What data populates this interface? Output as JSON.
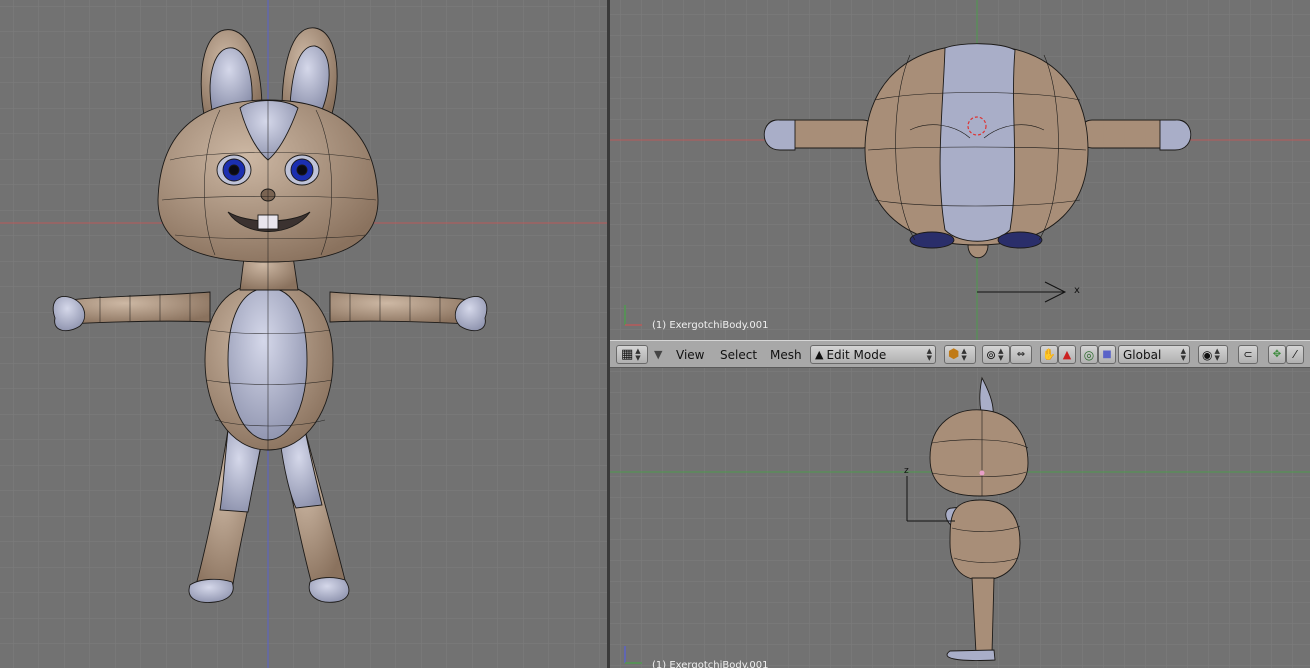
{
  "viewports": {
    "front": {
      "object_label": ""
    },
    "top": {
      "object_label": "(1) ExergotchiBody.001",
      "axis_x_label": "x"
    },
    "side": {
      "object_label": "(1) ExergotchiBody.001",
      "axis_z_label": "z"
    }
  },
  "header": {
    "menus": [
      "View",
      "Select",
      "Mesh"
    ],
    "mode": "Edit Mode",
    "transform_orientation": "Global",
    "icons": {
      "editor_type": "grid-icon",
      "shading": "solid-shading-icon",
      "pivot": "pivot-icon",
      "layers": "layers-icon",
      "grab": "hand-icon",
      "vertex_select": "vertex-select-icon",
      "edge_select": "edge-select-icon",
      "face_select": "face-select-icon",
      "proportional": "proportional-icon",
      "snap": "magnet-icon"
    }
  },
  "colors": {
    "viewport_bg": "#727272",
    "grid": "#7e7e7e",
    "x_axis": "#b85a5a",
    "y_axis": "#4f9a4f",
    "z_axis": "#5a63c8",
    "skin": "#a88e78",
    "belly": "#a9aec8",
    "eye": "#1b2fb0"
  }
}
